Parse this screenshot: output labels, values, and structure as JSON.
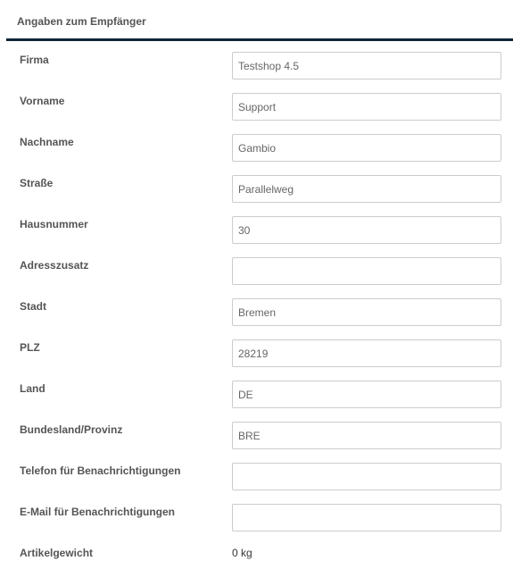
{
  "title": "Angaben zum Empfänger",
  "fields": [
    {
      "label": "Firma",
      "value": "Testshop 4.5"
    },
    {
      "label": "Vorname",
      "value": "Support"
    },
    {
      "label": "Nachname",
      "value": "Gambio"
    },
    {
      "label": "Straße",
      "value": "Parallelweg"
    },
    {
      "label": "Hausnummer",
      "value": "30"
    },
    {
      "label": "Adresszusatz",
      "value": ""
    },
    {
      "label": "Stadt",
      "value": "Bremen"
    },
    {
      "label": "PLZ",
      "value": "28219"
    },
    {
      "label": "Land",
      "value": "DE"
    },
    {
      "label": "Bundesland/Provinz",
      "value": "BRE"
    },
    {
      "label": "Telefon für Benachrichtigungen",
      "value": ""
    },
    {
      "label": "E-Mail für Benachrichtigungen",
      "value": ""
    }
  ],
  "weight": {
    "label": "Artikelgewicht",
    "value": "0 kg"
  }
}
